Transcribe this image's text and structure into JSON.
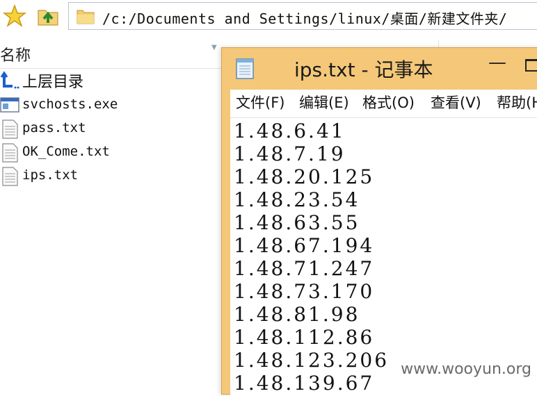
{
  "address_bar": {
    "path": "/c:/Documents and Settings/linux/桌面/新建文件夹/"
  },
  "toolbar": {
    "favorite_icon": "star-icon",
    "up_icon": "folder-up-icon"
  },
  "file_list": {
    "column_name": "名称",
    "items": [
      {
        "name": "上层目录",
        "icon": "parent-dir-icon"
      },
      {
        "name": "svchosts.exe",
        "icon": "exe-file-icon"
      },
      {
        "name": "pass.txt",
        "icon": "text-file-icon"
      },
      {
        "name": "OK_Come.txt",
        "icon": "text-file-icon"
      },
      {
        "name": "ips.txt",
        "icon": "text-file-icon"
      }
    ]
  },
  "notepad": {
    "title": "ips.txt - 记事本",
    "menu": [
      "文件(F)",
      "编辑(E)",
      "格式(O)",
      "查看(V)",
      "帮助(H)"
    ],
    "lines": [
      "1.48.6.41",
      "1.48.7.19",
      "1.48.20.125",
      "1.48.23.54",
      "1.48.63.55",
      "1.48.67.194",
      "1.48.71.247",
      "1.48.73.170",
      "1.48.81.98",
      "1.48.112.86",
      "1.48.123.206",
      "1.48.139.67"
    ]
  },
  "watermark": "www.wooyun.org",
  "colors": {
    "notepad_frame": "#f4c878",
    "address_border": "#b8c3d1"
  }
}
